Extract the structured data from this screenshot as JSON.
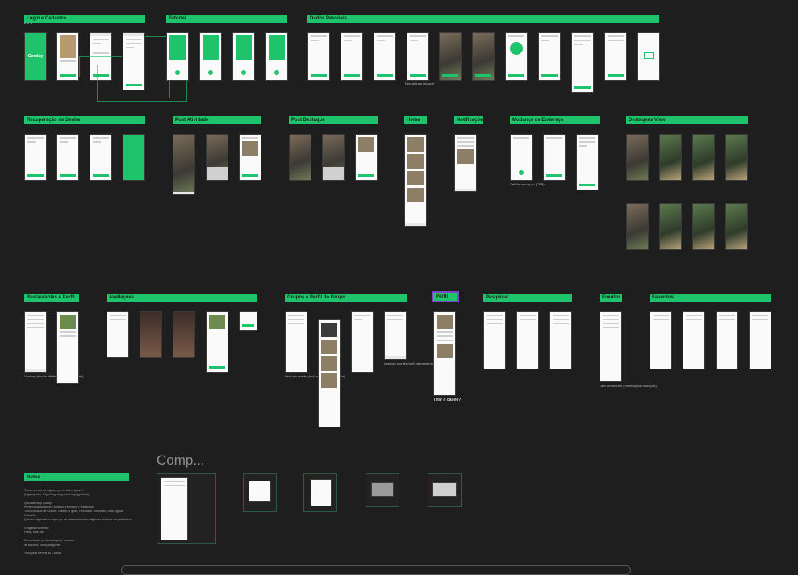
{
  "sections": [
    {
      "key": "login",
      "title": "Login e Cadastro"
    },
    {
      "key": "tutorial",
      "title": "Tutorial"
    },
    {
      "key": "dados",
      "title": "Dados Pessoais"
    },
    {
      "key": "recuperacao",
      "title": "Recuperação de Senha"
    },
    {
      "key": "post_atividade",
      "title": "Post Atividade"
    },
    {
      "key": "post_destaque",
      "title": "Post Destaque"
    },
    {
      "key": "home",
      "title": "Home"
    },
    {
      "key": "notificacoes",
      "title": "Notificações"
    },
    {
      "key": "mudanca",
      "title": "Mudança de Endereço"
    },
    {
      "key": "destaques_view",
      "title": "Destaques View"
    },
    {
      "key": "restaurantes",
      "title": "Restaurantes e Perfil"
    },
    {
      "key": "avaliacoes",
      "title": "Avaliações"
    },
    {
      "key": "grupos",
      "title": "Grupos e Perfil do Grupo"
    },
    {
      "key": "perfil",
      "title": "Perfil"
    },
    {
      "key": "pesquisar",
      "title": "Pesquisar"
    },
    {
      "key": "eventos",
      "title": "Eventos"
    },
    {
      "key": "favoritos",
      "title": "Favoritos"
    },
    {
      "key": "notes",
      "title": "Notes"
    }
  ],
  "brand_splash": "Gonday",
  "comp_title": "Comp...",
  "perfil_caption": "Tirar o cabeo?",
  "notes_lines": [
    "Trocar o texto do Ingdoxy prêm, lorem ipsum?",
    "(Ingdoxy.Link: https://ingxoxyy.com/nxypigg/studio)",
    "",
    "Quedate Stop Quedy",
    "Perfil Social incomum: Amador, Ferrouvor Profissional",
    "Tipo: Entrante de Cursos, Criterio el grota, Recordeu, Recordeu, SME, Ignoxi Criovtrite",
    "Queden algumas cervejas por sim várias otimizam algumas relativas em polidasem",
    "",
    "Gingdtrad sexentto",
    "Filtrar, filtre, do.",
    "",
    "Comentados as fotos do perfil nos sins",
    "de Bonons, cerfe(owig)sete?",
    "",
    "Todo para o Perfil do Cultivar"
  ],
  "captions": {
    "dados": "Dev.definas ibrowurl",
    "mudanca": "Cellular ensay,ou (CPB)",
    "restaurantes": "Usei um (mudia nitidim) camagindia(siria)",
    "grupos1": "Usei um monter (rod) spad cat.monte(chr)",
    "grupos2": "Usei um mouter (rod) cat.mmd mouter(chr)",
    "eventos": "Usei um mouter (eventos) cat.mmd(chr)"
  }
}
